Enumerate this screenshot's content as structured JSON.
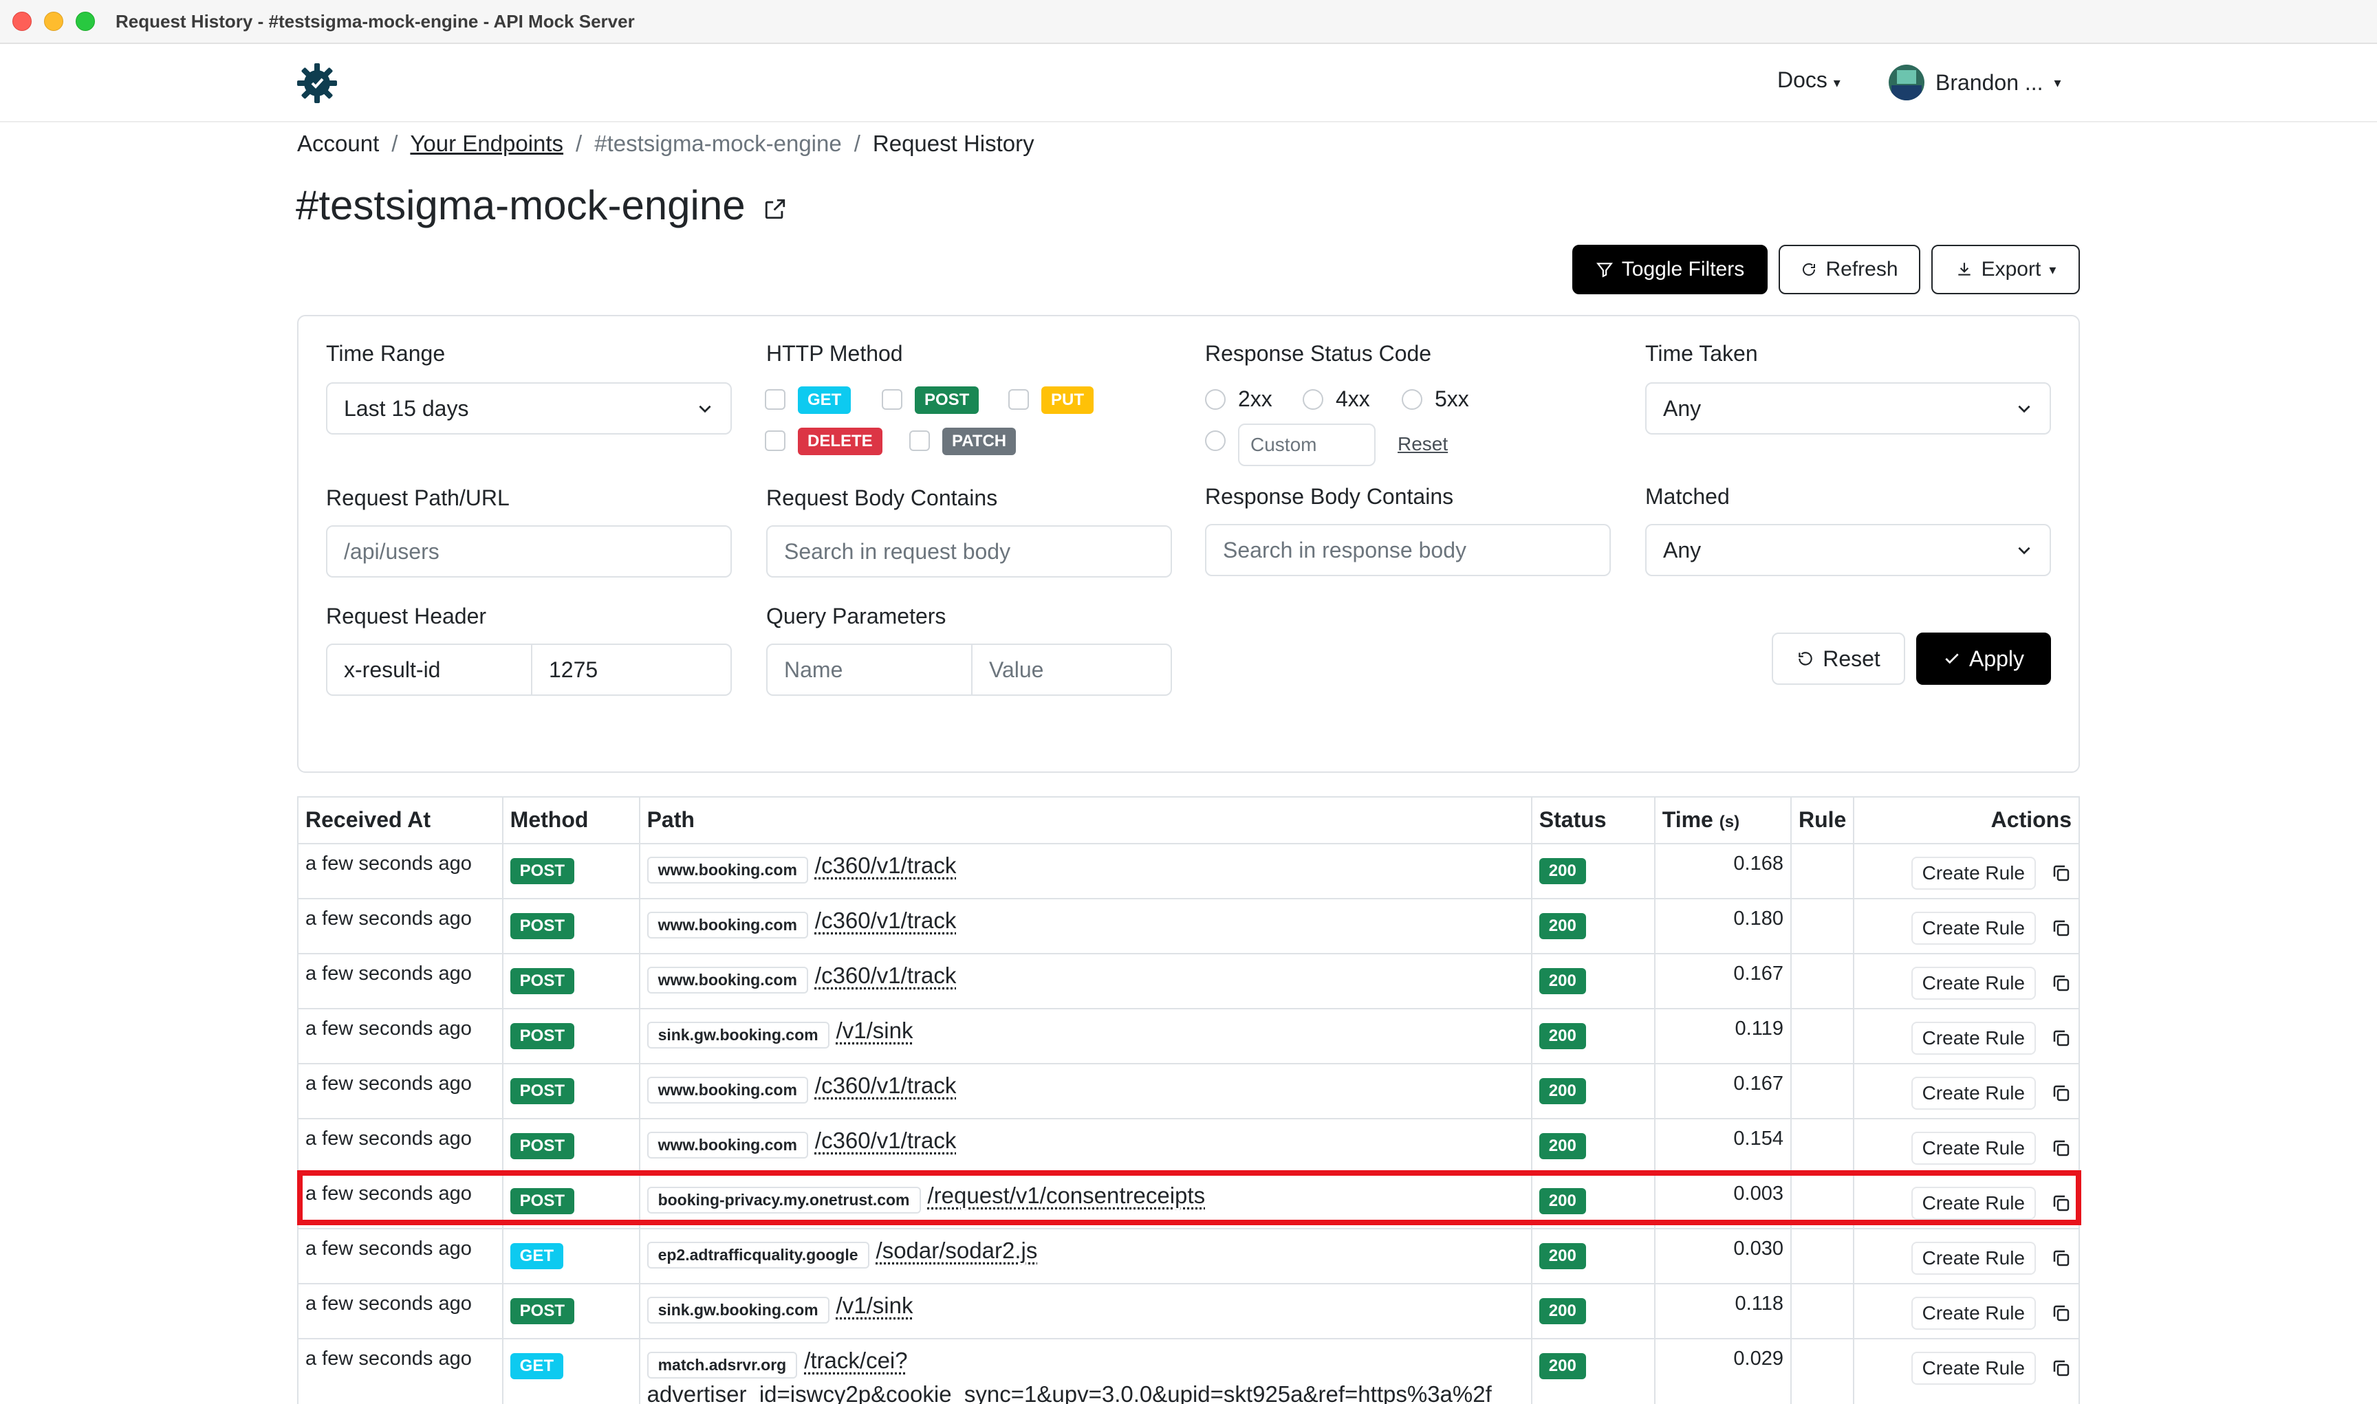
{
  "window": {
    "title": "Request History - #testsigma-mock-engine - API Mock Server"
  },
  "nav": {
    "docs": "Docs",
    "user": "Brandon ..."
  },
  "breadcrumb": {
    "account": "Account",
    "endpoints": "Your Endpoints",
    "current_endpoint": "#testsigma-mock-engine",
    "page": "Request History"
  },
  "page": {
    "title": "#testsigma-mock-engine"
  },
  "toolbar": {
    "toggle_filters": "Toggle Filters",
    "refresh": "Refresh",
    "export": "Export"
  },
  "filters": {
    "time_range": {
      "label": "Time Range",
      "value": "Last 15 days"
    },
    "http_method": {
      "label": "HTTP Method",
      "get": "GET",
      "post": "POST",
      "put": "PUT",
      "delete": "DELETE",
      "patch": "PATCH"
    },
    "status_code": {
      "label": "Response Status Code",
      "s2xx": "2xx",
      "s4xx": "4xx",
      "s5xx": "5xx",
      "custom_placeholder": "Custom",
      "reset": "Reset"
    },
    "time_taken": {
      "label": "Time Taken",
      "value": "Any"
    },
    "path": {
      "label": "Request Path/URL",
      "placeholder": "/api/users"
    },
    "req_body": {
      "label": "Request Body Contains",
      "placeholder": "Search in request body"
    },
    "resp_body": {
      "label": "Response Body Contains",
      "placeholder": "Search in response body"
    },
    "matched": {
      "label": "Matched",
      "value": "Any"
    },
    "header": {
      "label": "Request Header",
      "name": "x-result-id",
      "value": "1275"
    },
    "query": {
      "label": "Query Parameters",
      "name_placeholder": "Name",
      "value_placeholder": "Value"
    },
    "reset_btn": "Reset",
    "apply_btn": "Apply"
  },
  "table": {
    "headers": {
      "received": "Received At",
      "method": "Method",
      "path": "Path",
      "status": "Status",
      "time": "Time",
      "time_unit": "(s)",
      "rule": "Rule",
      "actions": "Actions"
    },
    "create_rule": "Create Rule",
    "rows": [
      {
        "received": "a few seconds ago",
        "method": "POST",
        "host": "www.booking.com",
        "path": "/c360/v1/track",
        "status": "200",
        "time": "0.168"
      },
      {
        "received": "a few seconds ago",
        "method": "POST",
        "host": "www.booking.com",
        "path": "/c360/v1/track",
        "status": "200",
        "time": "0.180"
      },
      {
        "received": "a few seconds ago",
        "method": "POST",
        "host": "www.booking.com",
        "path": "/c360/v1/track",
        "status": "200",
        "time": "0.167"
      },
      {
        "received": "a few seconds ago",
        "method": "POST",
        "host": "sink.gw.booking.com",
        "path": "/v1/sink",
        "status": "200",
        "time": "0.119"
      },
      {
        "received": "a few seconds ago",
        "method": "POST",
        "host": "www.booking.com",
        "path": "/c360/v1/track",
        "status": "200",
        "time": "0.167"
      },
      {
        "received": "a few seconds ago",
        "method": "POST",
        "host": "www.booking.com",
        "path": "/c360/v1/track",
        "status": "200",
        "time": "0.154"
      },
      {
        "received": "a few seconds ago",
        "method": "POST",
        "host": "booking-privacy.my.onetrust.com",
        "path": "/request/v1/consentreceipts",
        "status": "200",
        "time": "0.003"
      },
      {
        "received": "a few seconds ago",
        "method": "GET",
        "host": "ep2.adtrafficquality.google",
        "path": "/sodar/sodar2.js",
        "status": "200",
        "time": "0.030"
      },
      {
        "received": "a few seconds ago",
        "method": "POST",
        "host": "sink.gw.booking.com",
        "path": "/v1/sink",
        "status": "200",
        "time": "0.118"
      },
      {
        "received": "a few seconds ago",
        "method": "GET",
        "host": "match.adsrvr.org",
        "path": "/track/cei?",
        "path_cont": "advertiser_id=iswcy2p&cookie_sync=1&upv=3.0.0&upid=skt925a&ref=https%3a%2f",
        "status": "200",
        "time": "0.029"
      }
    ]
  },
  "colors": {
    "post": "#198754",
    "get": "#0dcaf0",
    "put": "#ffc107",
    "delete": "#dc3545",
    "patch": "#6c757d",
    "status_ok": "#198754",
    "highlight": "#e8131c"
  }
}
